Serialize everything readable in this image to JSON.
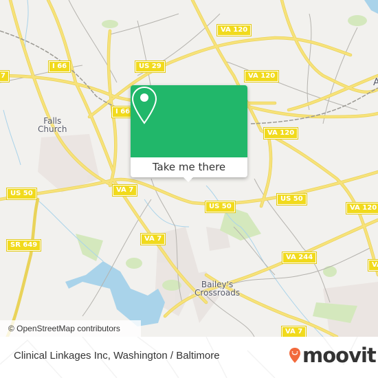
{
  "map": {
    "attribution": "© OpenStreetMap contributors",
    "places": [
      {
        "name": "Falls Church",
        "lines": [
          "Falls",
          "Church"
        ]
      },
      {
        "name": "Bailey's Crossroads",
        "lines": [
          "Bailey's",
          "Crossroads"
        ]
      },
      {
        "name": "A",
        "lines": [
          "A"
        ]
      }
    ],
    "shields": [
      "I 66",
      "US 29",
      "I 66",
      "7",
      "VA 120",
      "VA 120",
      "VA 120",
      "US 50",
      "VA 7",
      "SR 649",
      "VA 7",
      "US 50",
      "US 50",
      "VA 120",
      "VA 244",
      "VA",
      "VA 7"
    ],
    "colors": {
      "background": "#f2f1ee",
      "major_road": "#f4dc6b",
      "minor_road": "#b5b3ae",
      "water": "#a9d3ea",
      "park": "#d4e8bd",
      "shield": "#f1da1c"
    }
  },
  "popup": {
    "icon": "map-pin-icon",
    "action_label": "Take me there",
    "color": "#21b76a"
  },
  "footer": {
    "title": "Clinical Linkages Inc, Washington / Baltimore",
    "brand": "moovit",
    "brand_icon": "moovit-pin-icon",
    "brand_color": "#f26a3c"
  }
}
